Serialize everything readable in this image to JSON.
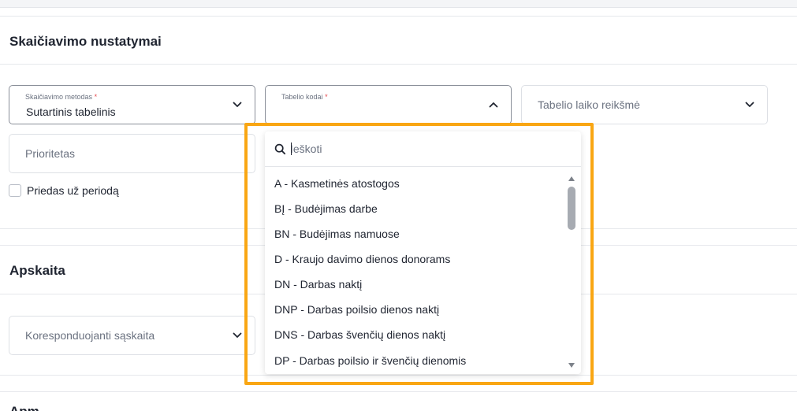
{
  "sections": {
    "calc_title": "Skaičiavimo nustatymai",
    "accounting_title": "Apskaita",
    "next_title_partial": "Apm"
  },
  "fields": {
    "method": {
      "label": "Skaičiavimo metodas",
      "required": "*",
      "value": "Sutartinis tabelinis"
    },
    "codes": {
      "label": "Tabelio kodai",
      "required": "*"
    },
    "time_value": {
      "placeholder": "Tabelio laiko reikšmė"
    },
    "priority": {
      "placeholder": "Prioritetas"
    },
    "account": {
      "placeholder": "Koresponduojanti sąskaita"
    }
  },
  "checkbox": {
    "label": "Priedas už periodą",
    "checked": false
  },
  "dropdown": {
    "search_placeholder": "Ieškoti",
    "options": [
      "A - Kasmetinės atostogos",
      "BĮ - Budėjimas darbe",
      "BN - Budėjimas namuose",
      "D - Kraujo davimo dienos donorams",
      "DN - Darbas naktį",
      "DNP - Darbas poilsio dienos naktį",
      "DNS - Darbas švenčių dienos naktį",
      "DP - Darbas poilsio ir švenčių dienomis"
    ]
  },
  "colors": {
    "highlight": "#f9a613",
    "required": "#e5484d"
  },
  "icons": {
    "search": "search-icon",
    "chevron": "chevron-down-icon",
    "chevron_up": "chevron-up-icon"
  }
}
